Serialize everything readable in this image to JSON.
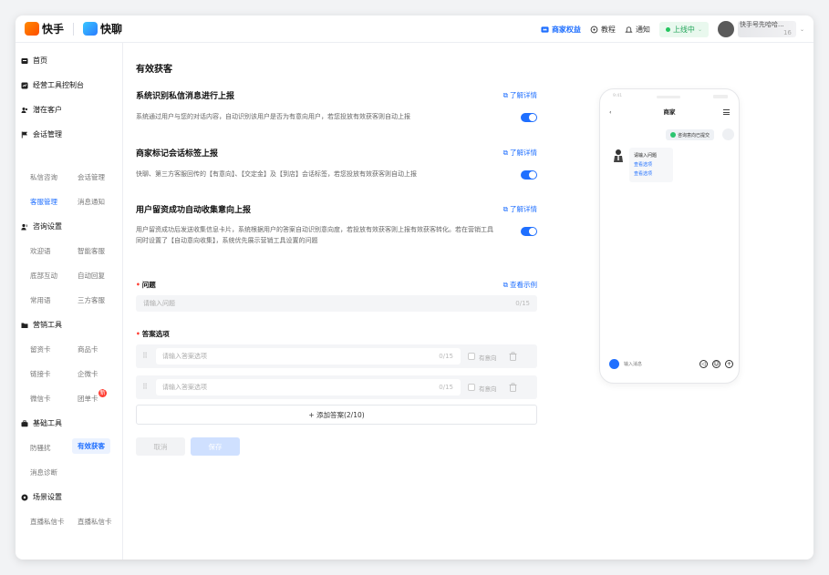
{
  "header": {
    "brand_kuaishou": "快手",
    "brand_kuailiao": "快聊",
    "merchant_rights": "商家权益",
    "tutorial": "教程",
    "notify": "通知",
    "status": "上线中",
    "user_name": "快手号先哈哈...",
    "user_sub": "16"
  },
  "sidebar": {
    "home": "首页",
    "console": "经营工具控制台",
    "potential": "潜在客户",
    "session_mgmt": "会话管理",
    "private_consult": "私信咨询",
    "session_manage": "会话管理",
    "service_mgmt": "客服管理",
    "msg_notify": "消息通知",
    "consult_settings": "咨询设置",
    "welcome": "欢迎语",
    "smart_service": "智能客服",
    "bottom_interact": "底部互动",
    "auto_reply": "自动回复",
    "common_phrases": "常用语",
    "third_service": "三方客服",
    "marketing_tools": "营销工具",
    "lead_card": "留资卡",
    "product_card": "商品卡",
    "link_card": "链接卡",
    "wecom_card": "企微卡",
    "wechat_card": "微信卡",
    "group_card": "团单卡",
    "group_badge": "新",
    "basic_tools": "基础工具",
    "anti_harass": "防骚扰",
    "effective_leads": "有效获客",
    "msg_diagnose": "消息诊断",
    "scene_settings": "场景设置",
    "live_private_1": "直播私信卡",
    "live_private_2": "直播私信卡"
  },
  "main": {
    "title": "有效获客",
    "detail_label": "了解详情",
    "sections": [
      {
        "title": "系统识别私信消息进行上报",
        "desc": "系统通过用户与您的对话内容，自动识别该用户是否为有意向用户，若您投放有效获客则自动上报"
      },
      {
        "title": "商家标记会话标签上报",
        "desc": "快聊、第三方客服回传的【有意向】、【交定金】及【到店】会话标签，若您投放有效获客则自动上报"
      },
      {
        "title": "用户留资成功自动收集意向上报",
        "desc": "用户留资成功后发送收集信息卡片，系统根据用户的答案自动识别意向度，若投放有效获客则上报有效获客转化。若在营销工具同时设置了【自动意向收集】，系统优先展示营销工具设置的问题"
      }
    ],
    "question_label": "问题",
    "view_example": "查看示例",
    "question_placeholder": "请输入问题",
    "question_count": "0/15",
    "answers_label": "答案选项",
    "answer_placeholder": "请输入答案选项",
    "answer_count": "0/15",
    "intent_label": "有意向",
    "add_answer": "+ 添加答案(2/10)",
    "cancel": "取消",
    "save": "保存"
  },
  "phone": {
    "status_time": "9:41",
    "title": "商家",
    "back": "‹",
    "tip": "咨询意向已提交",
    "card_question": "请输入问题",
    "card_answer_1": "查看选项",
    "card_answer_2": "查看选项",
    "input_placeholder": "输入消息"
  }
}
